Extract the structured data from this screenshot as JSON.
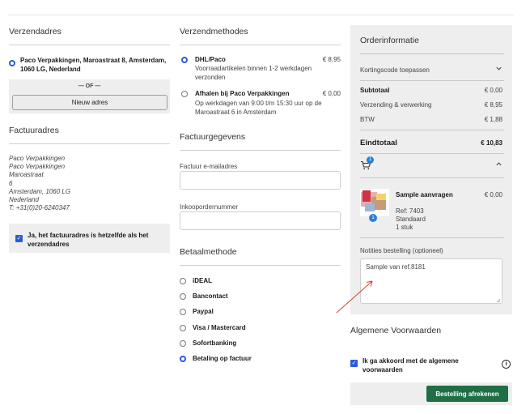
{
  "shipping": {
    "title": "Verzendadres",
    "address": "Paco Verpakkingen, Maroastraat 8, Amsterdam, 1060 LG, Nederland",
    "or": "— OF —",
    "new_address": "Nieuw adres"
  },
  "billing": {
    "title": "Factuuradres",
    "lines": [
      "Paco Verpakkingen",
      "Paco Verpakkingen",
      "Maroastraat",
      "6",
      "Amsterdam, 1060 LG",
      "Nederland",
      "T: +31(0)20-6240347"
    ],
    "same_label": "Ja, het factuuradres is hetzelfde als het verzendadres"
  },
  "shipping_methods": {
    "title": "Verzendmethodes",
    "options": [
      {
        "name": "DHL/Paco",
        "desc": "Voorraadartikelen binnen 1-2 werkdagen verzonden",
        "price": "€ 8,95",
        "selected": true
      },
      {
        "name": "Afhalen bij Paco Verpakkingen",
        "desc": "Op werkdagen van 9:00 t/m 15:30 uur op de Maroastraat 6 in Amsterdam",
        "price": "€ 0,00",
        "selected": false
      }
    ]
  },
  "invoice": {
    "title": "Factuurgegevens",
    "email_label": "Factuur e-mailadres",
    "email_value": "",
    "po_label": "Inkoopordernummer",
    "po_value": ""
  },
  "payment": {
    "title": "Betaalmethode",
    "options": [
      {
        "name": "iDEAL",
        "selected": false
      },
      {
        "name": "Bancontact",
        "selected": false
      },
      {
        "name": "Paypal",
        "selected": false
      },
      {
        "name": "Visa / Mastercard",
        "selected": false
      },
      {
        "name": "Sofortbanking",
        "selected": false
      },
      {
        "name": "Betaling op factuur",
        "selected": true
      }
    ]
  },
  "order": {
    "title": "Orderinformatie",
    "discount_label": "Kortingscode toepassen",
    "subtotal_label": "Subtotaal",
    "subtotal_value": "€ 0,00",
    "shipping_label": "Verzending & verwerking",
    "shipping_value": "€ 8,95",
    "vat_label": "BTW",
    "vat_value": "€ 1,88",
    "total_label": "Eindtotaal",
    "total_value": "€ 10,83",
    "cart_count": "1",
    "item": {
      "name": "Sample aanvragen",
      "price": "€ 0,00",
      "ref": "Ref: 7403",
      "variant": "Standaard",
      "qty_text": "1 stuk",
      "qty_badge": "1"
    },
    "notes_label": "Notities bestelling (optioneel)",
    "notes_value": "Sample van ref.8181"
  },
  "terms": {
    "title": "Algemene Voorwaarden",
    "agree_label": "Ik ga akkoord met de algemene voorwaarden",
    "info_icon": "info-icon"
  },
  "checkout_button": "Bestelling afrekenen",
  "colors": {
    "accent_blue": "#2a5bd7",
    "checkout_green": "#1f6e45",
    "annotation_red": "#d9402b",
    "cart_badge": "#2a7fd6"
  }
}
